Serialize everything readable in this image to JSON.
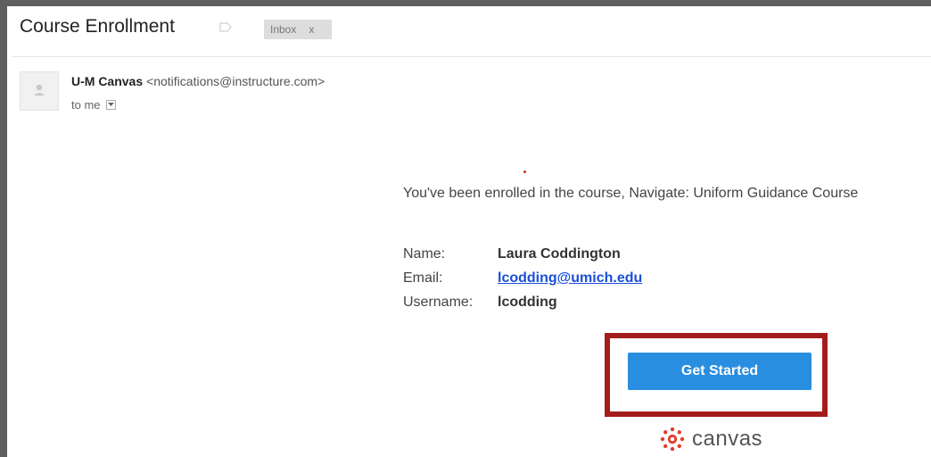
{
  "email": {
    "subject": "Course Enrollment",
    "labels": [
      {
        "name": "Inbox",
        "remove": "x"
      }
    ],
    "sender": {
      "name": "U-M Canvas",
      "address": "<notifications@instructure.com>"
    },
    "recipient": "to me"
  },
  "body": {
    "intro": "You've been enrolled in the course, Navigate: Uniform Guidance Course",
    "fields": {
      "name_label": "Name:",
      "name_value": "Laura Coddington",
      "email_label": "Email:",
      "email_value": "lcodding@umich.edu",
      "username_label": "Username:",
      "username_value": "lcodding"
    },
    "cta_label": "Get Started",
    "brand_name": "canvas"
  },
  "colors": {
    "frame": "#5f5f5f",
    "link": "#1a4fd6",
    "button": "#2a8ee0",
    "highlight": "#a51c1c",
    "brand": "#e03e2d"
  },
  "icons": {
    "label": "label-tag-icon",
    "avatar": "person-icon",
    "details": "chevron-down-icon",
    "brand": "canvas-logo-icon"
  }
}
